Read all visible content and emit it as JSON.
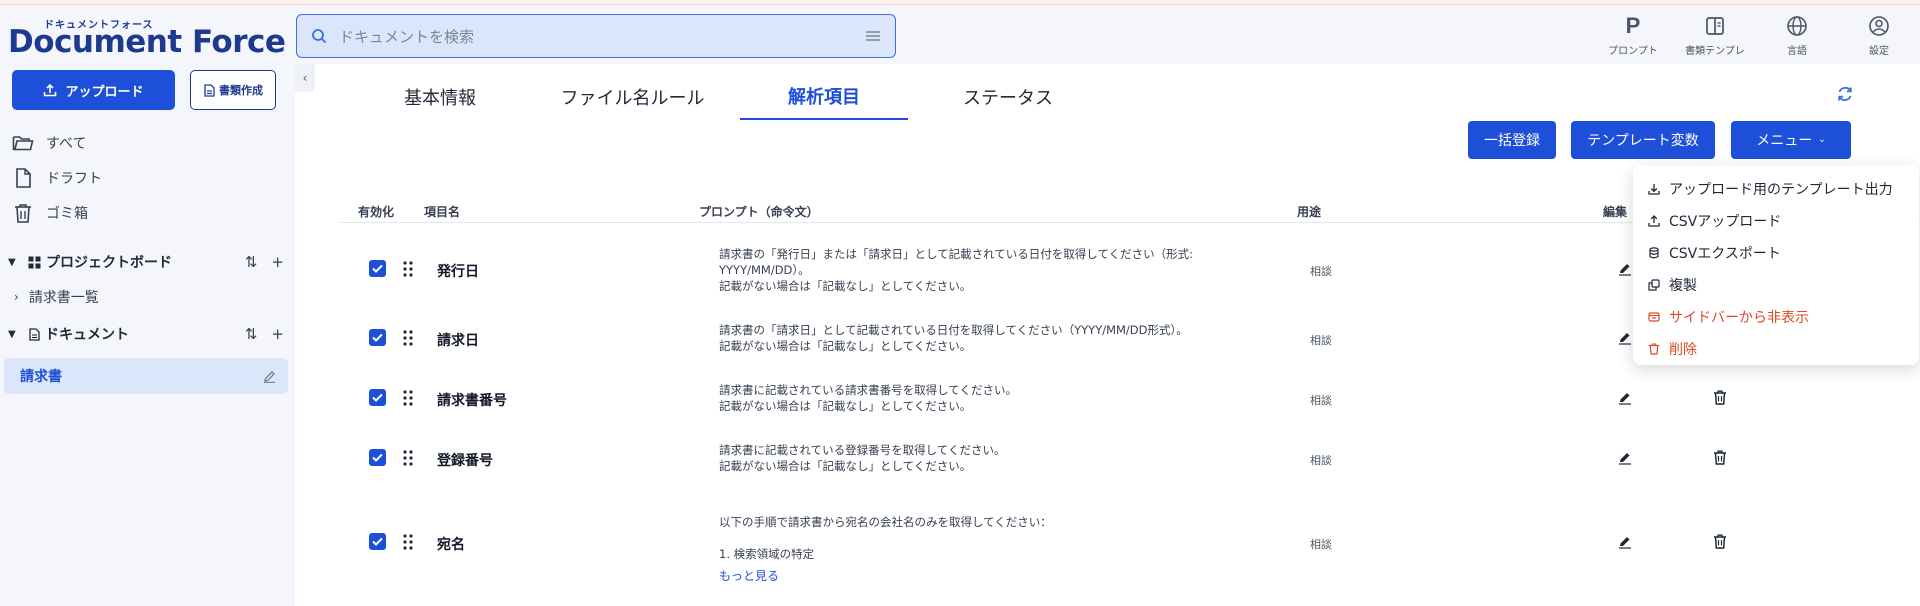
{
  "app": {
    "logo_ruby": "ドキュメントフォース",
    "logo_main": "Document Force"
  },
  "search": {
    "placeholder": "ドキュメントを検索"
  },
  "top_nav": [
    {
      "label": "プロンプト",
      "icon": "prompt-icon"
    },
    {
      "label": "書類テンプレ",
      "icon": "template-icon"
    },
    {
      "label": "言語",
      "icon": "globe-icon"
    },
    {
      "label": "設定",
      "icon": "user-settings-icon"
    }
  ],
  "sidebar": {
    "upload_label": "アップロード",
    "create_label": "書類作成",
    "items": [
      {
        "label": "すべて",
        "icon": "folder-icon"
      },
      {
        "label": "ドラフト",
        "icon": "document-icon"
      },
      {
        "label": "ゴミ箱",
        "icon": "trash-icon"
      }
    ],
    "project_board": {
      "label": "プロジェクトボード",
      "sub": "請求書一覧"
    },
    "documents": {
      "label": "ドキュメント",
      "active": "請求書"
    }
  },
  "tabs": [
    "基本情報",
    "ファイル名ルール",
    "解析項目",
    "ステータス"
  ],
  "active_tab": "解析項目",
  "actions": {
    "bulk": "一括登録",
    "template_vars": "テンプレート変数",
    "menu": "メニュー"
  },
  "table": {
    "headers": {
      "enabled": "有効化",
      "name": "項目名",
      "prompt": "プロンプト（命令文）",
      "usage": "用途",
      "edit": "編集"
    },
    "rows": [
      {
        "name": "発行日",
        "prompt": "請求書の「発行日」または「請求日」として記載されている日付を取得してください（形式:\nYYYY/MM/DD）。\n記載がない場合は「記載なし」としてください。",
        "usage": "相談"
      },
      {
        "name": "請求日",
        "prompt": "請求書の「請求日」として記載されている日付を取得してください（YYYY/MM/DD形式）。\n記載がない場合は「記載なし」としてください。",
        "usage": "相談"
      },
      {
        "name": "請求書番号",
        "prompt": "請求書に記載されている請求書番号を取得してください。\n記載がない場合は「記載なし」としてください。",
        "usage": "相談"
      },
      {
        "name": "登録番号",
        "prompt": "請求書に記載されている登録番号を取得してください。\n記載がない場合は「記載なし」としてください。",
        "usage": "相談"
      },
      {
        "name": "宛名",
        "prompt": "以下の手順で請求書から宛名の会社名のみを取得してください：\n\n1. 検索領域の特定",
        "more": "もっと見る",
        "usage": "相談"
      }
    ]
  },
  "menu_items": [
    {
      "label": "アップロード用のテンプレート出力",
      "icon": "download-icon",
      "danger": false
    },
    {
      "label": "CSVアップロード",
      "icon": "upload-icon",
      "danger": false
    },
    {
      "label": "CSVエクスポート",
      "icon": "database-icon",
      "danger": false
    },
    {
      "label": "複製",
      "icon": "copy-icon",
      "danger": false
    },
    {
      "label": "サイドバーから非表示",
      "icon": "hide-icon",
      "danger": true
    },
    {
      "label": "削除",
      "icon": "trash-icon",
      "danger": true
    }
  ],
  "colors": {
    "primary": "#1e4fd8",
    "brand": "#1d3a8f",
    "danger": "#dc4a26",
    "active_bg": "#dbe6fb"
  }
}
